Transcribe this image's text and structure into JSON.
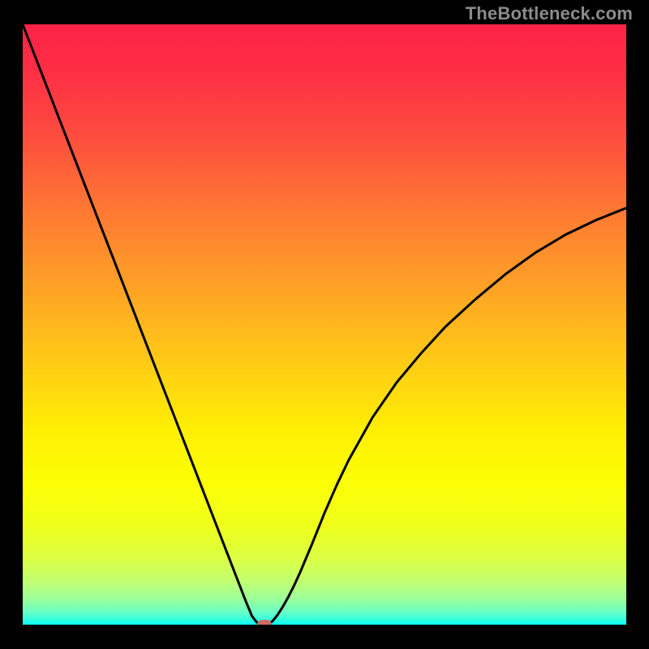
{
  "watermark": "TheBottleneck.com",
  "chart_data": {
    "type": "line",
    "title": "",
    "xlabel": "",
    "ylabel": "",
    "xlim": [
      0,
      100
    ],
    "ylim": [
      0,
      100
    ],
    "series": [
      {
        "name": "bottleneck-curve",
        "x": [
          0,
          5,
          10,
          15,
          20,
          25,
          28,
          30,
          32,
          34,
          36,
          37,
          38,
          38.7,
          39.3,
          40,
          40.7,
          41.4,
          42.2,
          43.1,
          44,
          45,
          46,
          48,
          50,
          52,
          54,
          58,
          62,
          66,
          70,
          75,
          80,
          85,
          90,
          95,
          100
        ],
        "y": [
          100,
          87,
          74,
          61,
          48,
          35,
          27.2,
          22,
          16.8,
          11.6,
          6.4,
          3.8,
          1.4,
          0.5,
          0,
          0,
          0,
          0.6,
          1.6,
          3.0,
          4.6,
          6.6,
          8.8,
          13.6,
          18.6,
          23.2,
          27.4,
          34.6,
          40.4,
          45.2,
          49.6,
          54.2,
          58.4,
          62.0,
          65.0,
          67.4,
          69.4
        ]
      }
    ],
    "marker": {
      "x": 40,
      "y": 0,
      "color": "#cf6d65"
    },
    "gradient_stops": [
      {
        "offset": 0,
        "color": "#fd2246"
      },
      {
        "offset": 8,
        "color": "#fd2f44"
      },
      {
        "offset": 18,
        "color": "#fd4b3f"
      },
      {
        "offset": 30,
        "color": "#fe7534"
      },
      {
        "offset": 42,
        "color": "#fe9c28"
      },
      {
        "offset": 55,
        "color": "#ffc717"
      },
      {
        "offset": 68,
        "color": "#fff003"
      },
      {
        "offset": 77,
        "color": "#fbff05"
      },
      {
        "offset": 84,
        "color": "#eeff1e"
      },
      {
        "offset": 89,
        "color": "#dbff44"
      },
      {
        "offset": 93,
        "color": "#bfff73"
      },
      {
        "offset": 96,
        "color": "#97ffa0"
      },
      {
        "offset": 98,
        "color": "#66ffc8"
      },
      {
        "offset": 100,
        "color": "#0bfff2"
      }
    ]
  }
}
